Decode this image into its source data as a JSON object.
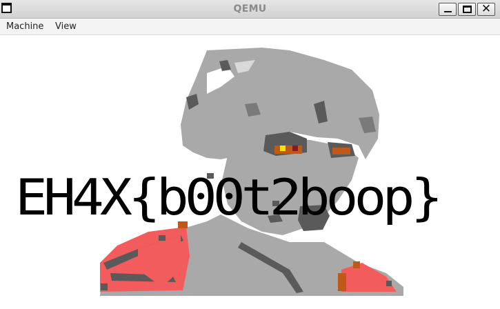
{
  "window": {
    "title": "QEMU",
    "icons": {
      "app": "window-icon",
      "minimize": "minimize-icon",
      "maximize": "maximize-icon",
      "close": "close-icon"
    }
  },
  "menu": {
    "items": [
      {
        "label": "Machine"
      },
      {
        "label": "View"
      }
    ]
  },
  "screen": {
    "flag_text": "EH4X{b00t2boop}",
    "colors": {
      "background": "#ffffff",
      "light_gray": "#a9a9a9",
      "dark_gray": "#5a5a5a",
      "red": "#f25c5c",
      "orange": "#c0581a",
      "yellow": "#f2e600"
    }
  }
}
